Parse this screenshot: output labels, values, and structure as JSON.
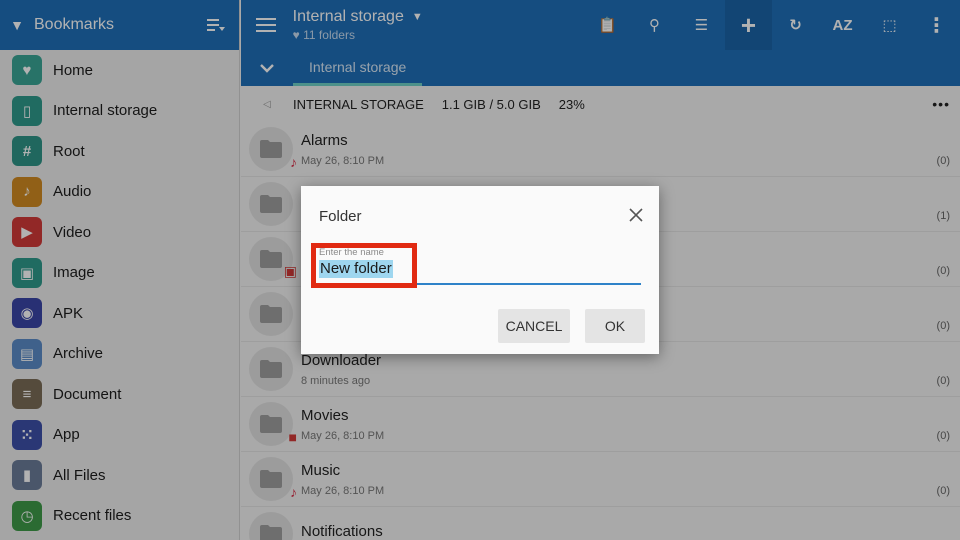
{
  "sidebar": {
    "title": "Bookmarks",
    "items": [
      {
        "label": "Home",
        "icon": "heart-icon",
        "color": "#3aa596",
        "glyph": "♥"
      },
      {
        "label": "Internal storage",
        "icon": "phone-icon",
        "color": "#2f9a8c",
        "glyph": "▯"
      },
      {
        "label": "Root",
        "icon": "hash-icon",
        "color": "#2e9487",
        "glyph": "#"
      },
      {
        "label": "Audio",
        "icon": "music-note-icon",
        "color": "#d08a21",
        "glyph": "♪"
      },
      {
        "label": "Video",
        "icon": "play-icon",
        "color": "#d23a38",
        "glyph": "▶"
      },
      {
        "label": "Image",
        "icon": "image-icon",
        "color": "#2f9a8c",
        "glyph": "▣"
      },
      {
        "label": "APK",
        "icon": "android-icon",
        "color": "#3a45a6",
        "glyph": "◉"
      },
      {
        "label": "Archive",
        "icon": "archive-icon",
        "color": "#5b8cc8",
        "glyph": "▤"
      },
      {
        "label": "Document",
        "icon": "document-icon",
        "color": "#7a6c56",
        "glyph": "≡"
      },
      {
        "label": "App",
        "icon": "apps-grid-icon",
        "color": "#3d4fa8",
        "glyph": "⁙"
      },
      {
        "label": "All Files",
        "icon": "file-icon",
        "color": "#6b7c99",
        "glyph": "▮"
      },
      {
        "label": "Recent files",
        "icon": "clock-icon",
        "color": "#3e9a48",
        "glyph": "◷"
      }
    ]
  },
  "header": {
    "title": "Internal storage",
    "subtitle": "11 folders",
    "actions": [
      {
        "name": "clipboard-icon",
        "glyph": "📋"
      },
      {
        "name": "search-icon",
        "glyph": "⚲"
      },
      {
        "name": "view-list-icon",
        "glyph": "☰"
      },
      {
        "name": "add-icon",
        "glyph": "+"
      },
      {
        "name": "refresh-icon",
        "glyph": "↻"
      },
      {
        "name": "sort-az-icon",
        "glyph": "AZ"
      },
      {
        "name": "select-all-icon",
        "glyph": "⬚"
      },
      {
        "name": "more-vert-icon",
        "glyph": "⋮"
      }
    ]
  },
  "tab": {
    "label": "Internal storage"
  },
  "path": {
    "location": "INTERNAL STORAGE",
    "usage": "1.1 GIB / 5.0 GIB",
    "percent": "23%"
  },
  "files": [
    {
      "name": "Alarms",
      "date": "May 26, 8:10 PM",
      "count": "(0)",
      "badge": "♪",
      "badge_color": "#d8324b"
    },
    {
      "name": "",
      "date": "",
      "count": "(1)",
      "badge": "",
      "badge_color": ""
    },
    {
      "name": "",
      "date": "",
      "count": "(0)",
      "badge": "▣",
      "badge_color": "#d23a38"
    },
    {
      "name": "",
      "date": "",
      "count": "(0)",
      "badge": "",
      "badge_color": ""
    },
    {
      "name": "Downloader",
      "date": "8 minutes ago",
      "count": "(0)",
      "badge": "",
      "badge_color": ""
    },
    {
      "name": "Movies",
      "date": "May 26, 8:10 PM",
      "count": "(0)",
      "badge": "■",
      "badge_color": "#d23a38"
    },
    {
      "name": "Music",
      "date": "May 26, 8:10 PM",
      "count": "(0)",
      "badge": "♪",
      "badge_color": "#d8324b"
    },
    {
      "name": "Notifications",
      "date": "",
      "count": "",
      "badge": "",
      "badge_color": ""
    }
  ],
  "dialog": {
    "title": "Folder",
    "field_label": "Enter the name",
    "field_value": "New folder",
    "cancel": "CANCEL",
    "ok": "OK"
  },
  "colors": {
    "primary": "#1f6fb8",
    "accent": "#6fd0c6",
    "highlight": "#e12a12",
    "field_line": "#2e82c8"
  }
}
